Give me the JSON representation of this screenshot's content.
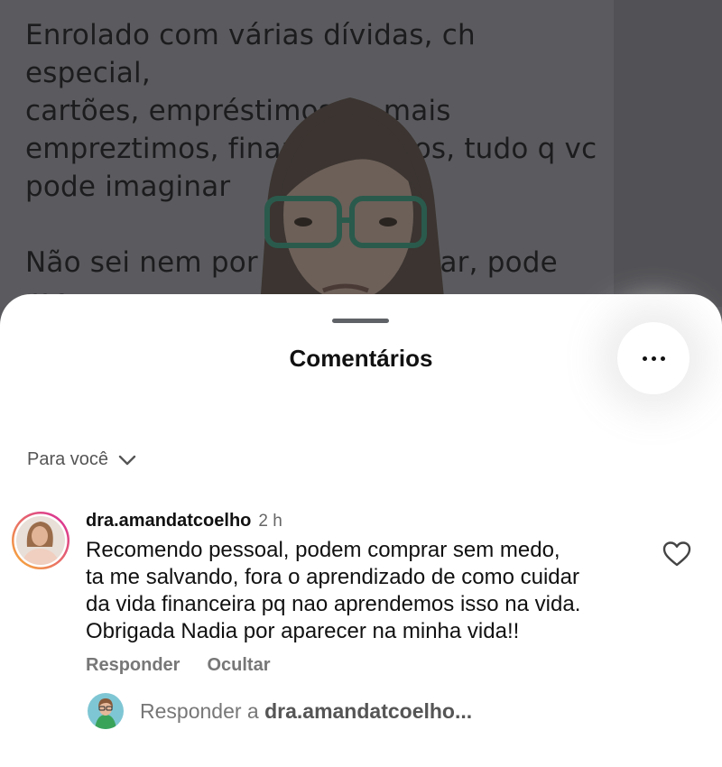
{
  "post": {
    "text": "Enrolado com várias dívidas, ch especial,\ncartões, empréstimoss e mais\nempreztimos, financiamentos, tudo q vc\npode imaginar\n\nNão sei nem por onde começar, pode me\najudar?"
  },
  "sheet": {
    "title": "Comentários",
    "more_icon": "more-horizontal-icon",
    "filter_label": "Para você",
    "filter_icon": "chevron-down-icon"
  },
  "comment": {
    "username": "dra.amandatcoelho",
    "time": "2 h",
    "text": "Recomendo pessoal, podem comprar sem medo,\nta me salvando, fora o aprendizado de como cuidar\nda vida financeira pq nao aprendemos isso na vida.\nObrigada Nadia por aparecer na minha vida!!",
    "reply_label": "Responder",
    "hide_label": "Ocultar",
    "like_icon": "heart-outline-icon"
  },
  "reply": {
    "prefix": "Responder a",
    "target": "dra.amandatcoelho..."
  },
  "colors": {
    "overlay": "#5a5a5e",
    "sheet": "#ffffff",
    "story_ring_start": "#f9b233",
    "story_ring_end": "#d6249f"
  }
}
